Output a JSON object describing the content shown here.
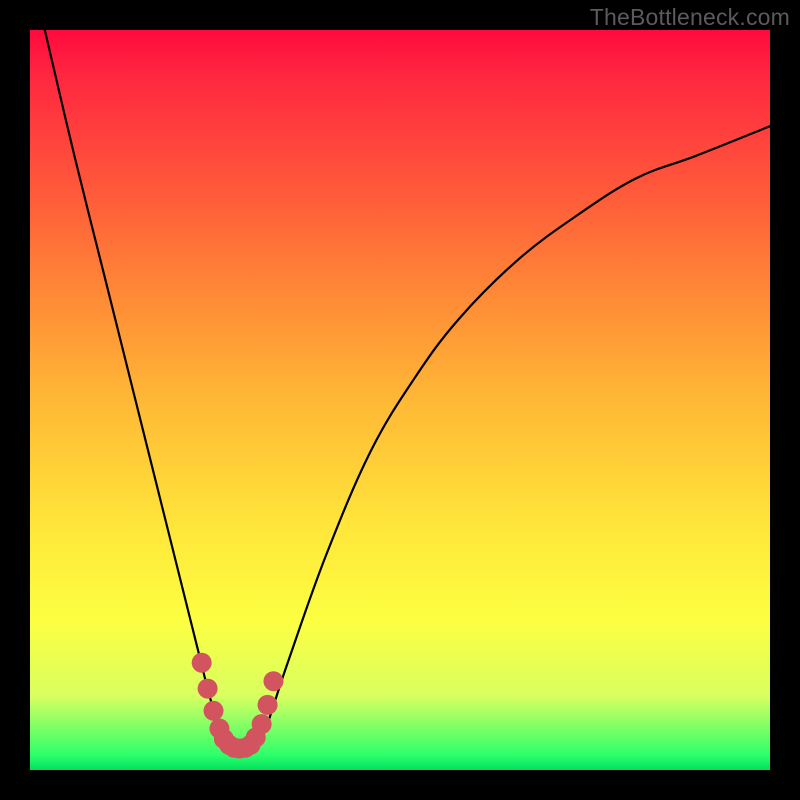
{
  "watermark": "TheBottleneck.com",
  "chart_data": {
    "type": "line",
    "title": "",
    "xlabel": "",
    "ylabel": "",
    "xlim": [
      0,
      100
    ],
    "ylim": [
      0,
      100
    ],
    "grid": false,
    "legend": false,
    "series": [
      {
        "name": "curve",
        "x": [
          2,
          6,
          10,
          14,
          18,
          22,
          23,
          24,
          25,
          26,
          27,
          28,
          29,
          30,
          31,
          32,
          33,
          35,
          40,
          46,
          52,
          58,
          66,
          74,
          82,
          90,
          100
        ],
        "y": [
          100,
          83,
          67,
          51,
          35,
          19,
          15,
          11,
          7.5,
          5,
          3.5,
          3,
          3,
          3.2,
          4,
          6,
          9,
          15,
          29,
          43,
          53,
          61,
          69,
          75,
          80,
          83,
          87
        ]
      }
    ],
    "highlight": {
      "name": "bottom-marker",
      "x": [
        23.2,
        24.0,
        24.8,
        25.6,
        26.2,
        26.9,
        27.6,
        28.3,
        29.1,
        29.8,
        30.5,
        31.3,
        32.1,
        32.9
      ],
      "y": [
        14.5,
        11.0,
        8.0,
        5.6,
        4.2,
        3.4,
        3.0,
        2.9,
        3.0,
        3.4,
        4.4,
        6.2,
        8.8,
        12.0
      ],
      "color": "#d1545f",
      "size": 10
    },
    "background_gradient": {
      "top": "#ff0a3c",
      "mid": "#ffe83a",
      "bottom": "#00e060"
    }
  }
}
